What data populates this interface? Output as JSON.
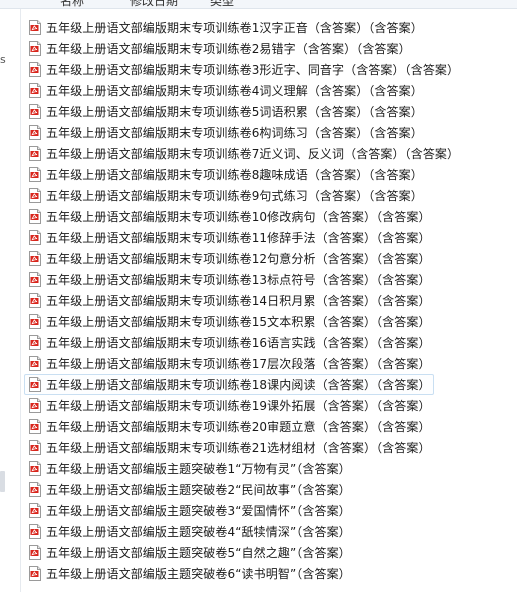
{
  "icons": {
    "file_icon": "pdf-icon",
    "accent_red": "#d9251c",
    "hover_border": "#c9dff2"
  },
  "header": {
    "clipped_columns": [
      "名称",
      "修改日期",
      "类型"
    ]
  },
  "nav": {
    "glyph": "s"
  },
  "files": [
    {
      "name": "五年级上册语文部编版期末专项训练卷1汉字正音（含答案）（含答案）"
    },
    {
      "name": "五年级上册语文部编版期末专项训练卷2易错字（含答案）（含答案）"
    },
    {
      "name": "五年级上册语文部编版期末专项训练卷3形近字、同音字（含答案）（含答案）"
    },
    {
      "name": "五年级上册语文部编版期末专项训练卷4词义理解（含答案）（含答案）"
    },
    {
      "name": "五年级上册语文部编版期末专项训练卷5词语积累（含答案）（含答案）"
    },
    {
      "name": "五年级上册语文部编版期末专项训练卷6构词练习（含答案）（含答案）"
    },
    {
      "name": "五年级上册语文部编版期末专项训练卷7近义词、反义词（含答案）（含答案）"
    },
    {
      "name": "五年级上册语文部编版期末专项训练卷8趣味成语（含答案）（含答案）"
    },
    {
      "name": "五年级上册语文部编版期末专项训练卷9句式练习（含答案）（含答案）"
    },
    {
      "name": "五年级上册语文部编版期末专项训练卷10修改病句（含答案）（含答案）"
    },
    {
      "name": "五年级上册语文部编版期末专项训练卷11修辞手法（含答案）（含答案）"
    },
    {
      "name": "五年级上册语文部编版期末专项训练卷12句意分析（含答案）（含答案）"
    },
    {
      "name": "五年级上册语文部编版期末专项训练卷13标点符号（含答案）（含答案）"
    },
    {
      "name": "五年级上册语文部编版期末专项训练卷14日积月累（含答案）（含答案）"
    },
    {
      "name": "五年级上册语文部编版期末专项训练卷15文本积累（含答案）（含答案）"
    },
    {
      "name": "五年级上册语文部编版期末专项训练卷16语言实践（含答案）（含答案）"
    },
    {
      "name": "五年级上册语文部编版期末专项训练卷17层次段落（含答案）（含答案）"
    },
    {
      "name": "五年级上册语文部编版期末专项训练卷18课内阅读（含答案）（含答案）",
      "hover": true
    },
    {
      "name": "五年级上册语文部编版期末专项训练卷19课外拓展（含答案）（含答案）"
    },
    {
      "name": "五年级上册语文部编版期末专项训练卷20审题立意（含答案）（含答案）"
    },
    {
      "name": "五年级上册语文部编版期末专项训练卷21选材组材（含答案）（含答案）"
    },
    {
      "name": "五年级上册语文部编版主题突破卷1“万物有灵”（含答案）"
    },
    {
      "name": "五年级上册语文部编版主题突破卷2“民间故事”（含答案）"
    },
    {
      "name": "五年级上册语文部编版主题突破卷3“爱国情怀”（含答案）"
    },
    {
      "name": "五年级上册语文部编版主题突破卷4“舐犊情深”（含答案）"
    },
    {
      "name": "五年级上册语文部编版主题突破卷5“自然之趣”（含答案）"
    },
    {
      "name": "五年级上册语文部编版主题突破卷6“读书明智”（含答案）"
    }
  ]
}
